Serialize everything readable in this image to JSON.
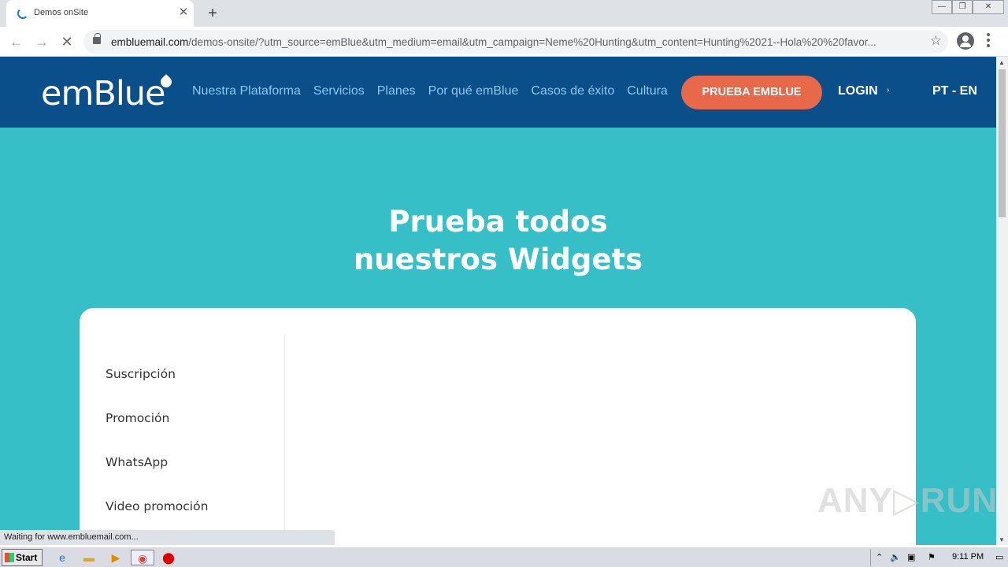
{
  "browser": {
    "tab_title": "Demos onSite",
    "tab_close": "✕",
    "new_tab": "+",
    "url_host": "embluemail.com",
    "url_path": "/demos-onsite/?utm_source=emBlue&utm_medium=email&utm_campaign=Neme%20Hunting&utm_content=Hunting%2021--Hola%20%20favor...",
    "status_text": "Waiting for www.embluemail.com..."
  },
  "site": {
    "logo": "emBlue",
    "nav": [
      "Nuestra Plataforma",
      "Servicios",
      "Planes",
      "Por qué emBlue",
      "Casos de éxito",
      "Cultura"
    ],
    "cta": "PRUEBA EMBLUE",
    "login": "LOGIN",
    "lang": "PT - EN",
    "hero_line1": "Prueba todos",
    "hero_line2": "nuestros Widgets",
    "widgets": [
      "Suscripción",
      "Promoción",
      "WhatsApp",
      "Video promoción"
    ]
  },
  "watermark": "ANY▷RUN",
  "taskbar": {
    "start": "Start",
    "clock": "9:11 PM"
  },
  "colors": {
    "nav_bg": "#0a4f8a",
    "page_bg": "#36bfc6",
    "cta_bg": "#e8684a",
    "nav_link": "#8ec6ec"
  }
}
